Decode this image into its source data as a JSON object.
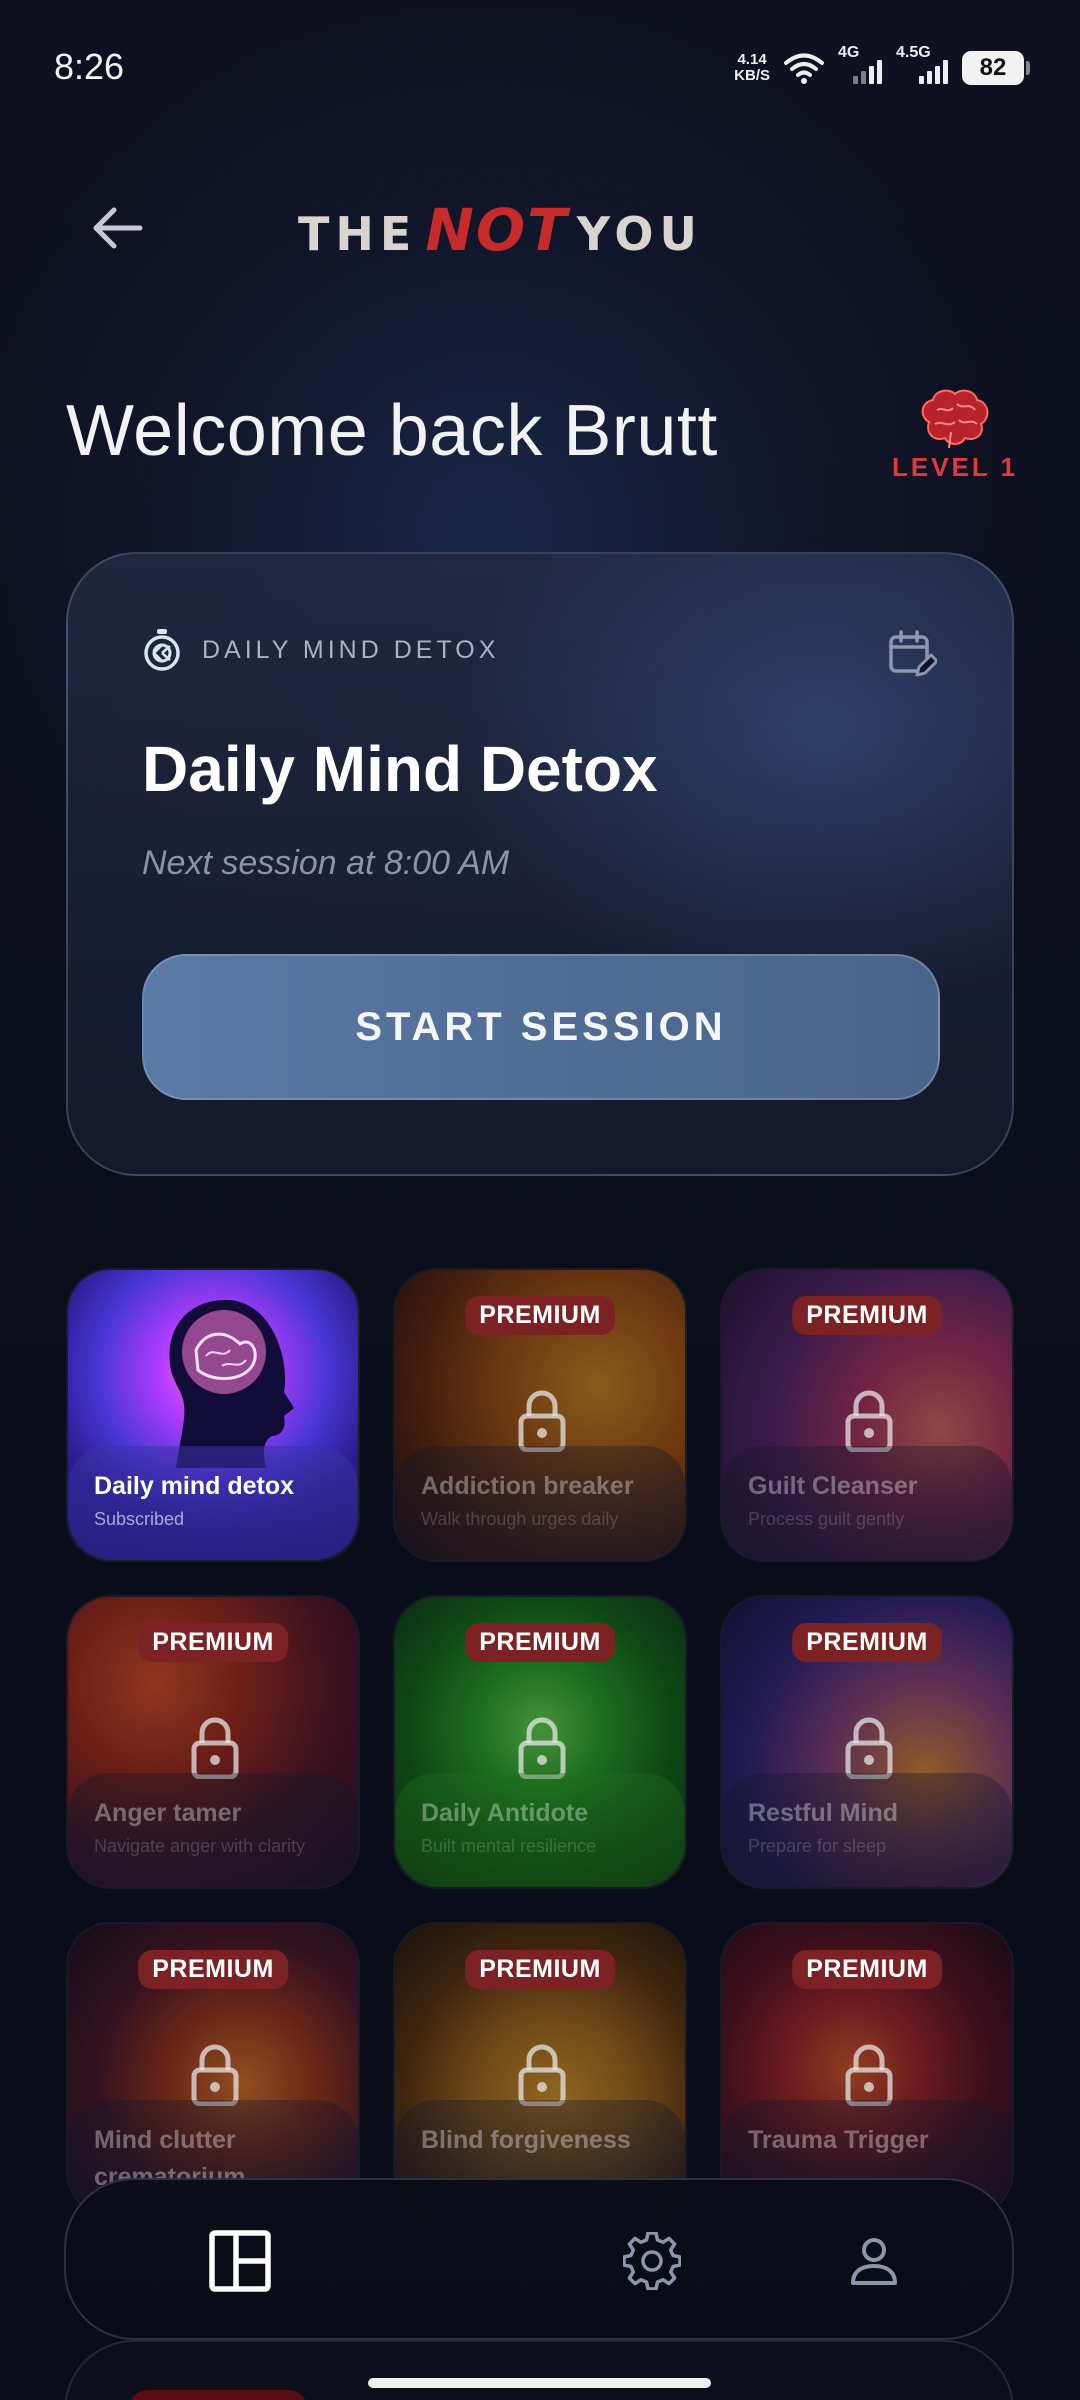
{
  "status": {
    "time": "8:26",
    "net_speed_value": "4.14",
    "net_speed_unit": "KB/S",
    "signal1_label": "4G",
    "signal2_label": "4.5G",
    "battery": "82"
  },
  "header": {
    "logo_the": "THE",
    "logo_not": "NOT",
    "logo_you": "YOU",
    "welcome": "Welcome back Brutt",
    "level": "LEVEL 1"
  },
  "session": {
    "kicker": "DAILY MIND DETOX",
    "title": "Daily Mind Detox",
    "subtitle": "Next session at 8:00 AM",
    "button": "START SESSION"
  },
  "programs": [
    {
      "title": "Daily mind detox",
      "subtitle": "Subscribed",
      "badge": "",
      "locked": false
    },
    {
      "title": "Addiction breaker",
      "subtitle": "Walk through urges daily",
      "badge": "PREMIUM",
      "locked": true
    },
    {
      "title": "Guilt Cleanser",
      "subtitle": "Process guilt gently",
      "badge": "PREMIUM",
      "locked": true
    },
    {
      "title": "Anger tamer",
      "subtitle": "Navigate anger with clarity",
      "badge": "PREMIUM",
      "locked": true
    },
    {
      "title": "Daily Antidote",
      "subtitle": "Built mental resilience",
      "badge": "PREMIUM",
      "locked": true
    },
    {
      "title": "Restful Mind",
      "subtitle": "Prepare for sleep",
      "badge": "PREMIUM",
      "locked": true
    },
    {
      "title": "Mind clutter crematorium",
      "subtitle": "",
      "badge": "PREMIUM",
      "locked": true
    },
    {
      "title": "Blind forgiveness",
      "subtitle": "",
      "badge": "PREMIUM",
      "locked": true
    },
    {
      "title": "Trauma Trigger",
      "subtitle": "",
      "badge": "PREMIUM",
      "locked": true
    }
  ],
  "icons": {
    "back": "arrow-left-icon",
    "stopwatch": "stopwatch-icon",
    "calendar": "calendar-edit-icon",
    "lock": "lock-icon",
    "nav_home": "dashboard-icon",
    "nav_settings": "gear-icon",
    "nav_profile": "person-icon"
  },
  "colors": {
    "accent_red": "#c62a2a",
    "level_red": "#e03a3a",
    "button_blue": "#5a7aa6",
    "premium_badge": "#7d2224"
  }
}
